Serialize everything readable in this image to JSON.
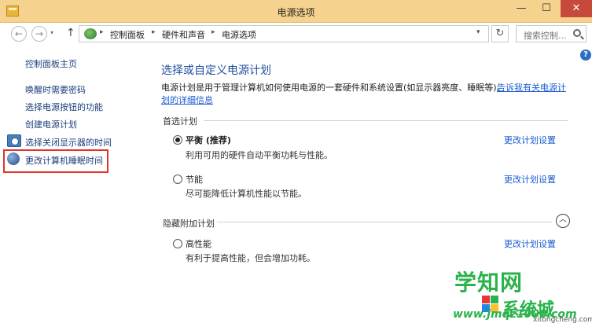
{
  "window": {
    "title": "电源选项",
    "controls": {
      "minimize": "—",
      "maximize": "☐",
      "close": "✕"
    }
  },
  "toolbar": {
    "back_icon": "←",
    "forward_icon": "→",
    "up_icon": "↑",
    "dropdown_icon": "▾",
    "refresh_icon": "↻",
    "breadcrumb": [
      "控制面板",
      "硬件和声音",
      "电源选项"
    ],
    "breadcrumb_sep": "▸",
    "search_placeholder": "搜索控制..."
  },
  "help": {
    "label": "?"
  },
  "sidebar": {
    "items": [
      {
        "label": "控制面板主页"
      },
      {
        "label": "唤醒时需要密码"
      },
      {
        "label": "选择电源按钮的功能"
      },
      {
        "label": "创建电源计划"
      },
      {
        "label": "选择关闭显示器的时间",
        "icon": "monitor-clock-icon"
      },
      {
        "label": "更改计算机睡眠时间",
        "icon": "sleep-moon-icon"
      }
    ]
  },
  "main": {
    "heading": "选择或自定义电源计划",
    "description": "电源计划是用于管理计算机如何使用电源的一套硬件和系统设置(如显示器亮度、睡眠等)。",
    "link_part1": "告诉我有关电源计",
    "link_part2": "划的详细信息",
    "preferred_group_label": "首选计划",
    "hidden_group_label": "隐藏附加计划",
    "collapse_icon": "︿",
    "plans": [
      {
        "name": "平衡 (推荐)",
        "description": "利用可用的硬件自动平衡功耗与性能。",
        "link": "更改计划设置",
        "selected": true
      },
      {
        "name": "节能",
        "description": "尽可能降低计算机性能以节能。",
        "link": "更改计划设置",
        "selected": false
      },
      {
        "name": "高性能",
        "description": "有利于提高性能，但会增加功耗。",
        "link": "更改计划设置",
        "selected": false
      }
    ]
  },
  "watermark": {
    "main": "学知网",
    "sub": "系统城",
    "domain": "www.jmqz1000.com",
    "small": "xitongcheng.com",
    "colors": {
      "green": "#2bb24c",
      "red": "#e53935",
      "blue": "#1e88e5",
      "yellow": "#fbc02d"
    }
  },
  "colors": {
    "titlebar": "#f6d28f",
    "close_button": "#c7493b",
    "link": "#1a5bd1",
    "heading": "#1d4e9e",
    "highlight": "#e0342b"
  }
}
